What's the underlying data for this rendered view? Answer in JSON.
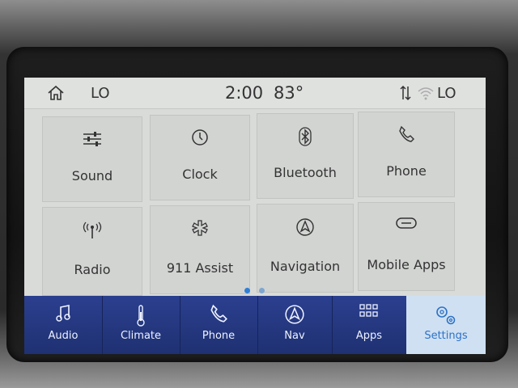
{
  "status_bar": {
    "left_label": "LO",
    "time": "2:00",
    "temperature": "83°",
    "right_label": "LO",
    "icons": [
      "home-icon",
      "sync-arrows-icon",
      "wifi-icon"
    ]
  },
  "tiles": [
    {
      "label": "Sound",
      "icon": "sliders-icon"
    },
    {
      "label": "Clock",
      "icon": "clock-icon"
    },
    {
      "label": "Bluetooth",
      "icon": "bluetooth-icon"
    },
    {
      "label": "Phone",
      "icon": "phone-icon"
    },
    {
      "label": "Radio",
      "icon": "antenna-icon"
    },
    {
      "label": "911 Assist",
      "icon": "asterisk-icon"
    },
    {
      "label": "Navigation",
      "icon": "navigation-icon"
    },
    {
      "label": "Mobile Apps",
      "icon": "mobile-apps-icon"
    }
  ],
  "page_indicator": {
    "pages": 2,
    "active": 1
  },
  "nav": {
    "items": [
      {
        "label": "Audio",
        "icon": "music-note-icon"
      },
      {
        "label": "Climate",
        "icon": "thermometer-icon"
      },
      {
        "label": "Phone",
        "icon": "phone-icon"
      },
      {
        "label": "Nav",
        "icon": "navigation-icon"
      },
      {
        "label": "Apps",
        "icon": "apps-grid-icon"
      },
      {
        "label": "Settings",
        "icon": "gears-icon"
      }
    ],
    "active": "Settings"
  },
  "colors": {
    "nav_bg": "#23367d",
    "active_nav_bg": "#cfe0f2",
    "active_nav_text": "#2d72c6",
    "screen_bg": "#d9dbd9"
  }
}
